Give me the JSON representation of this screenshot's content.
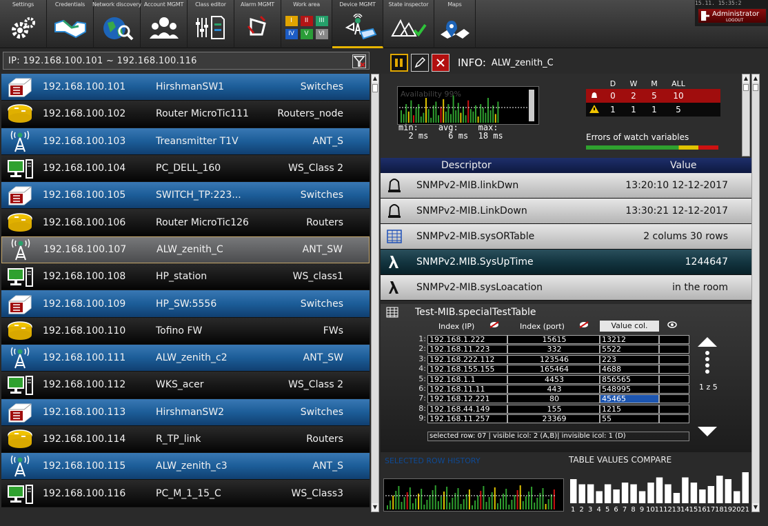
{
  "toolbar": {
    "items": [
      {
        "label": "Settings",
        "icon": "gears-icon"
      },
      {
        "label": "Credentials",
        "icon": "handshake-icon"
      },
      {
        "label": "Network discovery",
        "icon": "globe-search-icon"
      },
      {
        "label": "Account MGMT",
        "icon": "users-icon"
      },
      {
        "label": "Class editor",
        "icon": "class-editor-icon"
      },
      {
        "label": "Alarm MGMT",
        "icon": "alarm-bell-icon"
      },
      {
        "label": "Work area",
        "icon": "work-area-grid-icon",
        "cells": [
          "I",
          "II",
          "III",
          "IV",
          "V",
          "VI"
        ]
      },
      {
        "label": "Device MGMT",
        "icon": "device-network-icon",
        "active": true
      },
      {
        "label": "State inspector",
        "icon": "state-check-icon"
      },
      {
        "label": "Maps",
        "icon": "map-icon"
      }
    ],
    "clock": "15.11.   15:35:2",
    "user": "Administrator",
    "logout": "LOGOUT"
  },
  "filter": {
    "text": "IP: 192.168.100.101 ~ 192.168.100.116"
  },
  "devices": [
    {
      "icon": "switch-icon",
      "ip": "192.168.100.101",
      "name": "HirshmanSW1",
      "type": "Switches"
    },
    {
      "icon": "router-icon",
      "ip": "192.168.100.102",
      "name": "Router MicroTic111",
      "type": "Routers_node"
    },
    {
      "icon": "antenna-icon",
      "ip": "192.168.100.103",
      "name": "Treansmitter T1V",
      "type": "ANT_S"
    },
    {
      "icon": "workstation-icon",
      "ip": "192.168.100.104",
      "name": "PC_DELL_160",
      "type": "WS_Class 2"
    },
    {
      "icon": "switch-icon",
      "ip": "192.168.100.105",
      "name": "SWITCH_TP:223...",
      "type": "Switches"
    },
    {
      "icon": "router-icon",
      "ip": "192.168.100.106",
      "name": "Router MicroTic126",
      "type": "Routers"
    },
    {
      "icon": "antenna-icon",
      "ip": "192.168.100.107",
      "name": "ALW_zenith_C",
      "type": "ANT_SW",
      "selected": true
    },
    {
      "icon": "workstation-icon",
      "ip": "192.168.100.108",
      "name": "HP_station",
      "type": "WS_class1"
    },
    {
      "icon": "switch-icon",
      "ip": "192.168.100.109",
      "name": "HP_SW:5556",
      "type": "Switches"
    },
    {
      "icon": "router-icon",
      "ip": "192.168.100.110",
      "name": "Tofino FW",
      "type": "FWs"
    },
    {
      "icon": "antenna-icon",
      "ip": "192.168.100.111",
      "name": "ALW_zenith_c2",
      "type": "ANT_SW"
    },
    {
      "icon": "workstation-icon",
      "ip": "192.168.100.112",
      "name": "WKS_acer",
      "type": "WS_Class 2"
    },
    {
      "icon": "switch-icon",
      "ip": "192.168.100.113",
      "name": "HirshmanSW2",
      "type": "Switches"
    },
    {
      "icon": "router-icon",
      "ip": "192.168.100.114",
      "name": "R_TP_link",
      "type": "Routers"
    },
    {
      "icon": "antenna-icon",
      "ip": "192.168.100.115",
      "name": "ALW_zenith_c3",
      "type": "ANT_S"
    },
    {
      "icon": "workstation-icon",
      "ip": "192.168.100.116",
      "name": "PC_M_1_15_C",
      "type": "WS_Class3"
    }
  ],
  "info": {
    "label": "INFO:",
    "device": "ALW_zenith_C"
  },
  "availability": {
    "text": "Availability 99%",
    "min_label": "min:",
    "avg_label": "avg:",
    "max_label": "max:",
    "min": "2 ms",
    "avg": "6 ms",
    "max": "18 ms"
  },
  "alarms": {
    "headers": [
      "D",
      "W",
      "M",
      "ALL"
    ],
    "rows": [
      {
        "icon": "bell-icon",
        "values": [
          "0",
          "2",
          "5",
          "10"
        ],
        "color": "#a00d0d"
      },
      {
        "icon": "warning-icon",
        "values": [
          "1",
          "1",
          "1",
          "5"
        ],
        "color": "#0a0a0a"
      }
    ],
    "errors_label": "Errors of watch variables"
  },
  "descriptor": {
    "col_descriptor": "Descriptor",
    "col_value": "Value",
    "rows": [
      {
        "icon": "bell-outline-icon",
        "name": "SNMPv2-MIB.linkDwn",
        "value": "13:20:10 12-12-2017",
        "style": "light"
      },
      {
        "icon": "bell-outline-icon",
        "name": "SNMPv2-MIB.LinkDown",
        "value": "13:30:21 12-12-2017",
        "style": "light"
      },
      {
        "icon": "table-icon",
        "name": "SNMPv2-MIB.sysORTable",
        "value": "2 colums 30 rows",
        "style": "light"
      },
      {
        "icon": "lambda-icon",
        "name": "SNMPv2.MIB.SysUpTime",
        "value": "1244647",
        "style": "dark"
      },
      {
        "icon": "lambda-icon",
        "name": "SNMPv2-MIB.sysLoacation",
        "value": "in the room",
        "style": "light"
      }
    ]
  },
  "special": {
    "title": "Test-MIB.specialTestTable",
    "col1": "Index (IP)",
    "col2": "Index (port)",
    "col3": "Value col.",
    "rows": [
      {
        "n": "1:",
        "ip": "192.168.1.222",
        "port": "15615",
        "val": "13212"
      },
      {
        "n": "2:",
        "ip": "192.168.11.223",
        "port": "332",
        "val": "5522"
      },
      {
        "n": "3:",
        "ip": "192.168.222.112",
        "port": "123546",
        "val": "223"
      },
      {
        "n": "4:",
        "ip": "192.168.155.155",
        "port": "165464",
        "val": "4688"
      },
      {
        "n": "5:",
        "ip": "192.168.1.1",
        "port": "4453",
        "val": "856565"
      },
      {
        "n": "6:",
        "ip": "192.168.11.11",
        "port": "443",
        "val": "548995"
      },
      {
        "n": "7:",
        "ip": "192.168.12.221",
        "port": "80",
        "val": "45465",
        "highlight": true
      },
      {
        "n": "8:",
        "ip": "192.168.44.149",
        "port": "155",
        "val": "1215"
      },
      {
        "n": "9:",
        "ip": "192.168.11.257",
        "port": "23369",
        "val": "55"
      }
    ],
    "footer": "selected row: 07  | visible icol: 2 (A,B)| invisible icol: 1 (D)",
    "range": "1 z 5"
  },
  "history_label": "SELECTED ROW HISTORY",
  "compare_label": "TABLE VALUES COMPARE",
  "compare_ticks": [
    "1",
    "2",
    "3",
    "4",
    "5",
    "6",
    "7",
    "8",
    "9",
    "10",
    "11",
    "12",
    "13",
    "14",
    "15",
    "16",
    "17",
    "18",
    "19",
    "20",
    "21"
  ],
  "compare_values": [
    0.7,
    0.55,
    0.55,
    0.35,
    0.55,
    0.4,
    0.6,
    0.55,
    0.35,
    0.6,
    0.75,
    0.55,
    0.3,
    0.75,
    0.6,
    0.4,
    0.5,
    0.8,
    0.7,
    0.35,
    0.9
  ]
}
